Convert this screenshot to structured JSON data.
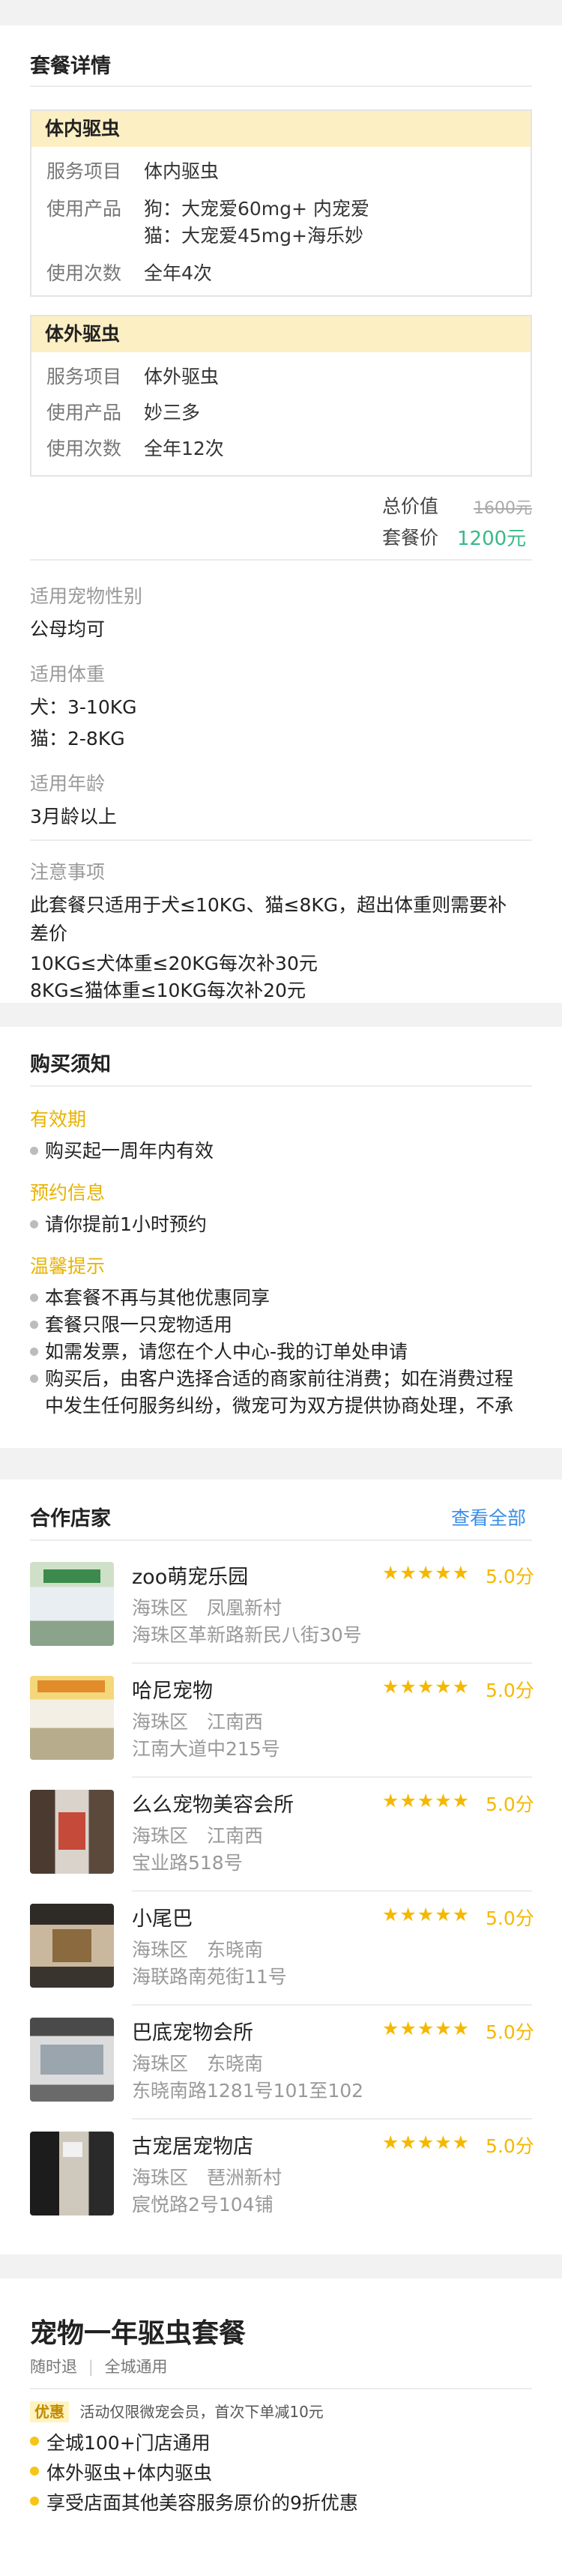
{
  "package_details": {
    "title": "套餐详情",
    "internal": {
      "header": "体内驱虫",
      "service_label": "服务项目",
      "service_value": "体内驱虫",
      "product_label": "使用产品",
      "product_line1": "狗：大宠爱60mg+ 内宠爱",
      "product_line2": "猫：大宠爱45mg+海乐妙",
      "times_label": "使用次数",
      "times_value": "全年4次"
    },
    "external": {
      "header": "体外驱虫",
      "service_label": "服务项目",
      "service_value": "体外驱虫",
      "product_label": "使用产品",
      "product_value": "妙三多",
      "times_label": "使用次数",
      "times_value": "全年12次"
    },
    "total_label": "总价值",
    "total_value": "1600元",
    "price_label": "套餐价",
    "price_value": "1200元",
    "gender_label": "适用宠物性别",
    "gender_value": "公母均可",
    "weight_label": "适用体重",
    "weight_dog": "犬：3-10KG",
    "weight_cat": "猫：2-8KG",
    "age_label": "适用年龄",
    "age_value": "3月龄以上",
    "notes_label": "注意事项",
    "notes_line1": "此套餐只适用于犬≤10KG、猫≤8KG，超出体重则需要补",
    "notes_line2": "差价",
    "notes_line3": "10KG≤犬体重≤20KG每次补30元",
    "notes_line4": "8KG≤猫体重≤10KG每次补20元"
  },
  "purchase_notes": {
    "title": "购买须知",
    "validity_label": "有效期",
    "validity_item": "购买起一周年内有效",
    "booking_label": "预约信息",
    "booking_item": "请你提前1小时预约",
    "tips_label": "温馨提示",
    "tips": [
      "本套餐不再与其他优惠同享",
      "套餐只限一只宠物适用",
      "如需发票，请您在个人中心-我的订单处申请",
      "购买后，由客户选择合适的商家前往消费；如在消费过程",
      "中发生任何服务纠纷，微宠可为双方提供协商处理，不承"
    ]
  },
  "stores": {
    "title": "合作店家",
    "view_all": "查看全部",
    "stars_text": "★★★★★",
    "items": [
      {
        "name": "zoo萌宠乐园",
        "area": "海珠区　凤凰新村",
        "address": "海珠区革新路新民八街30号",
        "score": "5.0分"
      },
      {
        "name": "哈尼宠物",
        "area": "海珠区　江南西",
        "address": "江南大道中215号",
        "score": "5.0分"
      },
      {
        "name": "么么宠物美容会所",
        "area": "海珠区　江南西",
        "address": "宝业路518号",
        "score": "5.0分"
      },
      {
        "name": "小尾巴",
        "area": "海珠区　东晓南",
        "address": "海联路南苑街11号",
        "score": "5.0分"
      },
      {
        "name": "巴底宠物会所",
        "area": "海珠区　东晓南",
        "address": "东晓南路1281号101至102",
        "score": "5.0分"
      },
      {
        "name": "古宠居宠物店",
        "area": "海珠区　琶洲新村",
        "address": "宸悦路2号104铺",
        "score": "5.0分"
      }
    ]
  },
  "product": {
    "title": "宠物一年驱虫套餐",
    "tag1": "随时退",
    "tag_sep": "|",
    "tag2": "全城通用",
    "promo_badge": "优惠",
    "promo_text": "活动仅限微宠会员，首次下单减10元",
    "features": [
      "全城100+门店通用",
      "体外驱虫+体内驱虫",
      "享受店面其他美容服务原价的9折优惠"
    ]
  },
  "colors": {
    "accent_yellow": "#f5c518",
    "price_green": "#3ab88a",
    "link_blue": "#3a8ee6",
    "star_gold": "#f5b800"
  }
}
